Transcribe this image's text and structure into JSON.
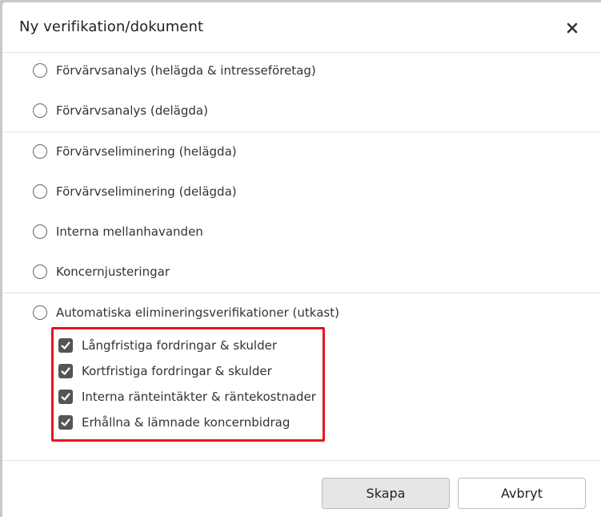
{
  "dialog": {
    "title": "Ny verifikation/dokument",
    "close_icon": "close-icon"
  },
  "options": [
    {
      "label": "Förvärvsanalys (helägda & intresseföretag)",
      "selected": false
    },
    {
      "label": "Förvärvsanalys (delägda)",
      "selected": false
    },
    {
      "label": "Förvärvseliminering (helägda)",
      "selected": false
    },
    {
      "label": "Förvärvseliminering (delägda)",
      "selected": false
    },
    {
      "label": "Interna mellanhavanden",
      "selected": false
    },
    {
      "label": "Koncernjusteringar",
      "selected": false
    },
    {
      "label": "Automatiska elimineringsverifikationer (utkast)",
      "selected": false
    }
  ],
  "sub_options": [
    {
      "label": "Långfristiga fordringar & skulder",
      "checked": true
    },
    {
      "label": "Kortfristiga fordringar & skulder",
      "checked": true
    },
    {
      "label": "Interna ränteintäkter & räntekostnader",
      "checked": true
    },
    {
      "label": "Erhållna & lämnade koncernbidrag",
      "checked": true
    }
  ],
  "buttons": {
    "create": "Skapa",
    "cancel": "Avbryt"
  },
  "colors": {
    "highlight": "#e8141e",
    "checkbox": "#555555"
  }
}
